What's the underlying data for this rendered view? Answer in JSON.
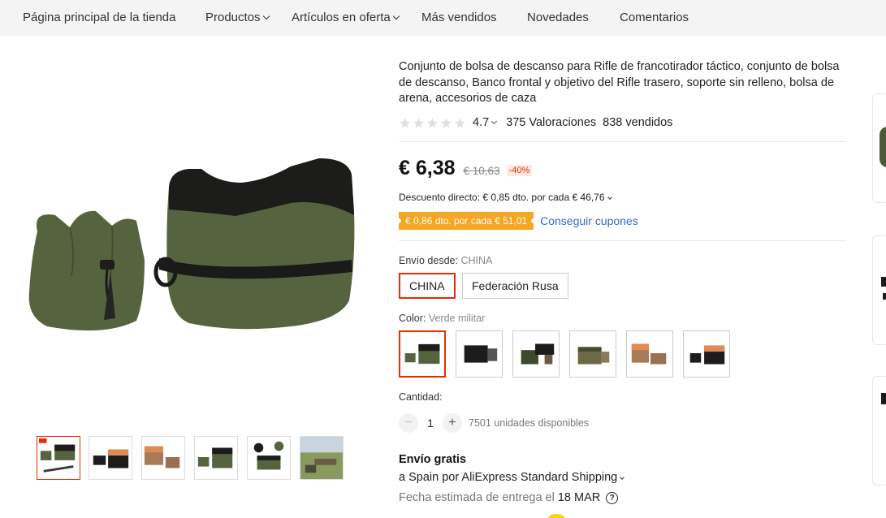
{
  "nav": {
    "items": [
      {
        "label": "Página principal de la tienda",
        "dropdown": false
      },
      {
        "label": "Productos",
        "dropdown": true
      },
      {
        "label": "Artículos en oferta",
        "dropdown": true
      },
      {
        "label": "Más vendidos",
        "dropdown": false
      },
      {
        "label": "Novedades",
        "dropdown": false
      },
      {
        "label": "Comentarios",
        "dropdown": false
      }
    ]
  },
  "product": {
    "title": "Conjunto de bolsa de descanso para Rifle de francotirador táctico, conjunto de bolsa de descanso, Banco frontal y objetivo del Rifle trasero, soporte sin relleno, bolsa de arena, accesorios de caza",
    "rating": "4.7",
    "reviews": "375 Valoraciones",
    "sold": "838 vendidos",
    "price": "€ 6,38",
    "old_price": "€ 10,63",
    "discount": "-40%",
    "direct_discount": "Descuento directo: € 0,85 dto. por cada € 46,76",
    "coupon_badge": "€ 0,86 dto. por cada € 51,01",
    "coupon_link": "Conseguir cupones"
  },
  "shipping_from": {
    "label": "Envío desde:",
    "selected": "CHINA",
    "options": [
      "CHINA",
      "Federación Rusa"
    ]
  },
  "color": {
    "label": "Color:",
    "selected": "Verde militar",
    "options": [
      "Verde militar",
      "Negro",
      "Negro verde",
      "Caqui",
      "Naranja camuflaje",
      "Negro naranja"
    ]
  },
  "quantity": {
    "label": "Cantidad:",
    "value": "1",
    "minus": "−",
    "plus": "+",
    "available": "7501 unidades disponibles"
  },
  "delivery": {
    "free_shipping": "Envío gratis",
    "ship_to": "a Spain por AliExpress Standard Shipping",
    "estimate_label": "Fecha estimada de entrega el",
    "estimate_date": "18 MAR",
    "help": "?"
  },
  "thumbnails": [
    "thumb-1",
    "thumb-2",
    "thumb-3",
    "thumb-4",
    "thumb-5",
    "thumb-6"
  ],
  "colors": {
    "accent": "#e62e04",
    "coupon": "#f5a623",
    "link": "#2e6bd3",
    "olive": "#4a5a3a",
    "black": "#1c1c1c"
  }
}
